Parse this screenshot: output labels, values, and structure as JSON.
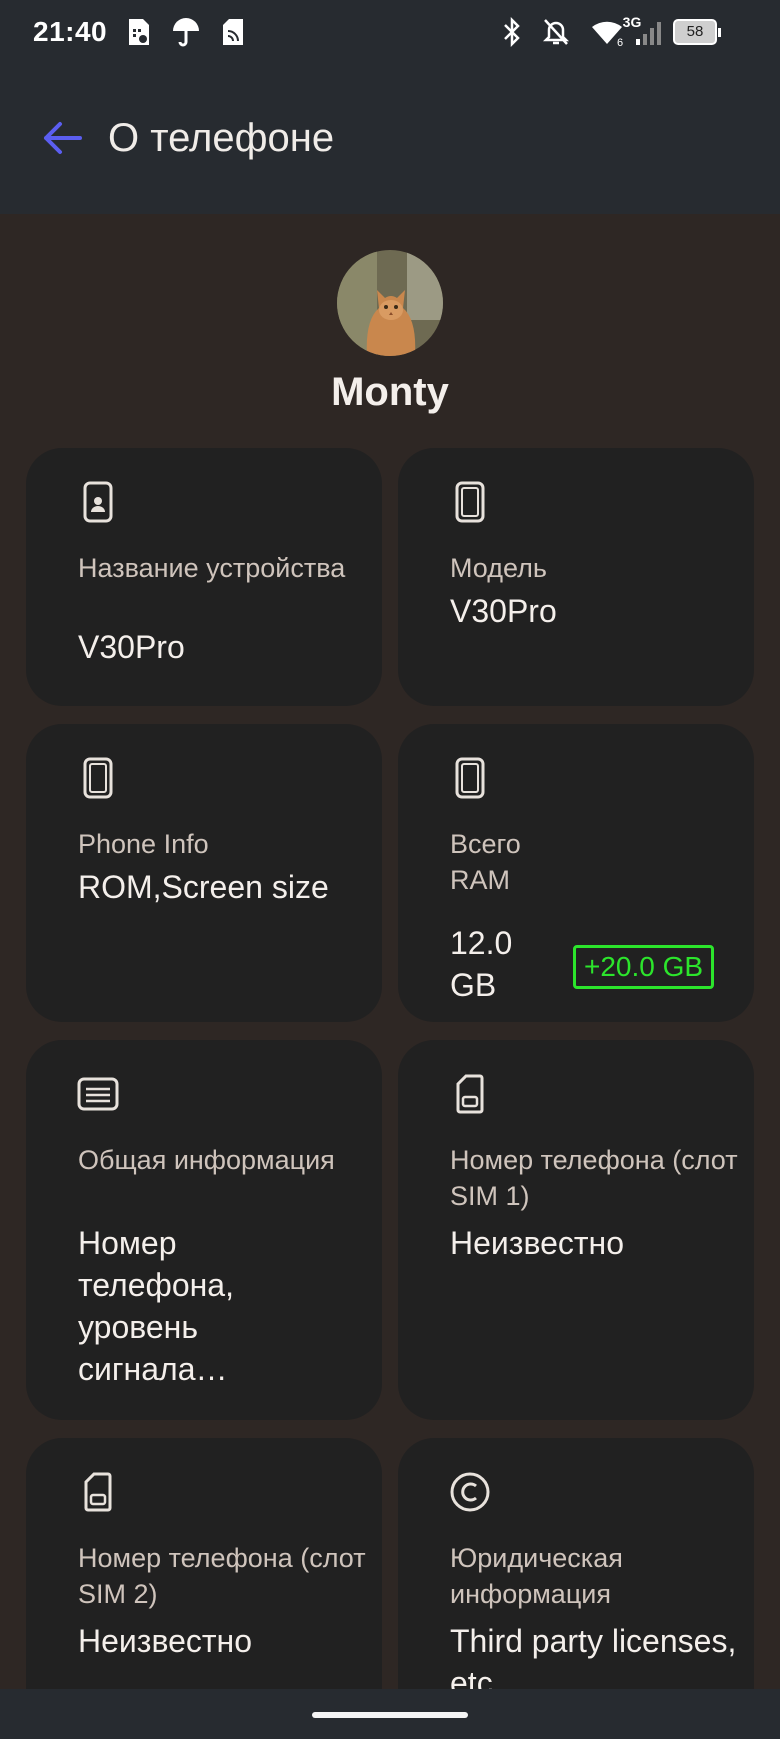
{
  "status_bar": {
    "time": "21:40",
    "network": "3G",
    "battery": "58",
    "icons": [
      "sim-settings-icon",
      "umbrella-icon",
      "sim-card-icon",
      "bluetooth-icon",
      "notifications-off-icon",
      "wifi-icon",
      "signal-icon",
      "battery-icon"
    ]
  },
  "header": {
    "title": "О телефоне",
    "back_icon": "arrow-left-icon",
    "accent_color": "#5b5ef0"
  },
  "profile": {
    "name": "Monty"
  },
  "cards": [
    {
      "icon": "phone-portrait-icon",
      "label": "Название устройства",
      "value": "V30Pro"
    },
    {
      "icon": "phone-icon",
      "label": "Модель",
      "value": "V30Pro"
    },
    {
      "icon": "phone-icon",
      "label": "Phone Info",
      "value": "ROM,Screen size"
    },
    {
      "icon": "phone-icon",
      "label": "Всего RAM",
      "value": "12.0 GB",
      "badge": "+20.0 GB",
      "badge_color": "#2ce52c"
    },
    {
      "icon": "document-icon",
      "label": "Общая информация",
      "value": "Номер телефона, уровень сигнала…"
    },
    {
      "icon": "sim-card-icon",
      "label": "Номер телефона (слот SIM 1)",
      "value": "Неизвестно"
    },
    {
      "icon": "sim-card-icon",
      "label": "Номер телефона (слот SIM 2)",
      "value": "Неизвестно"
    },
    {
      "icon": "copyright-icon",
      "label": "Юридическая информация",
      "value": "Third party licenses, etc"
    }
  ]
}
